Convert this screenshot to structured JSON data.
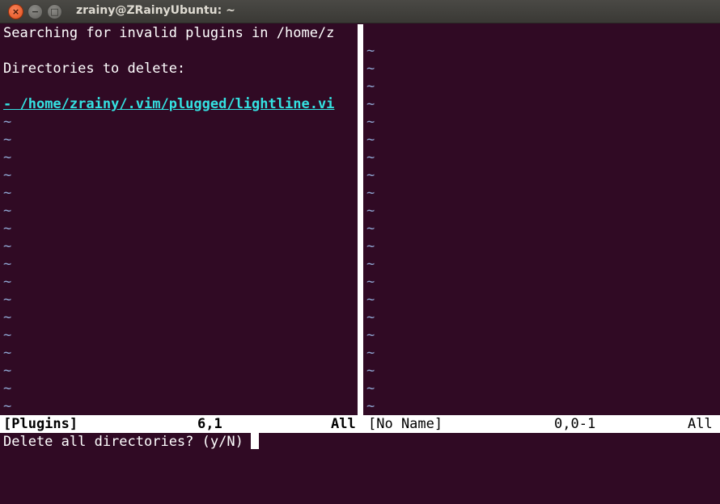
{
  "window": {
    "title": "zrainy@ZRainyUbuntu: ~",
    "close_glyph": "×",
    "minimize_glyph": "−",
    "maximize_glyph": "□"
  },
  "left_pane": {
    "lines": [
      "Searching for invalid plugins in /home/z",
      "",
      "Directories to delete:",
      "",
      "- /home/zrainy/.vim/plugged/lightline.vi"
    ],
    "link_prefix": "- ",
    "link_text": "/home/zrainy/.vim/plugged/lightline.vi",
    "tilde": "~"
  },
  "right_pane": {
    "tilde": "~"
  },
  "status_left": {
    "name": "[Plugins]",
    "position": "6,1",
    "scroll": "All"
  },
  "status_right": {
    "name": "[No Name]",
    "position": "0,0-1",
    "scroll": "All"
  },
  "command_line": {
    "prompt": "Delete all directories? (y/N)"
  },
  "colors": {
    "background": "#300a24",
    "tilde": "#8fa6d2",
    "link": "#34e2e2",
    "statusline_bg": "#ffffff"
  }
}
